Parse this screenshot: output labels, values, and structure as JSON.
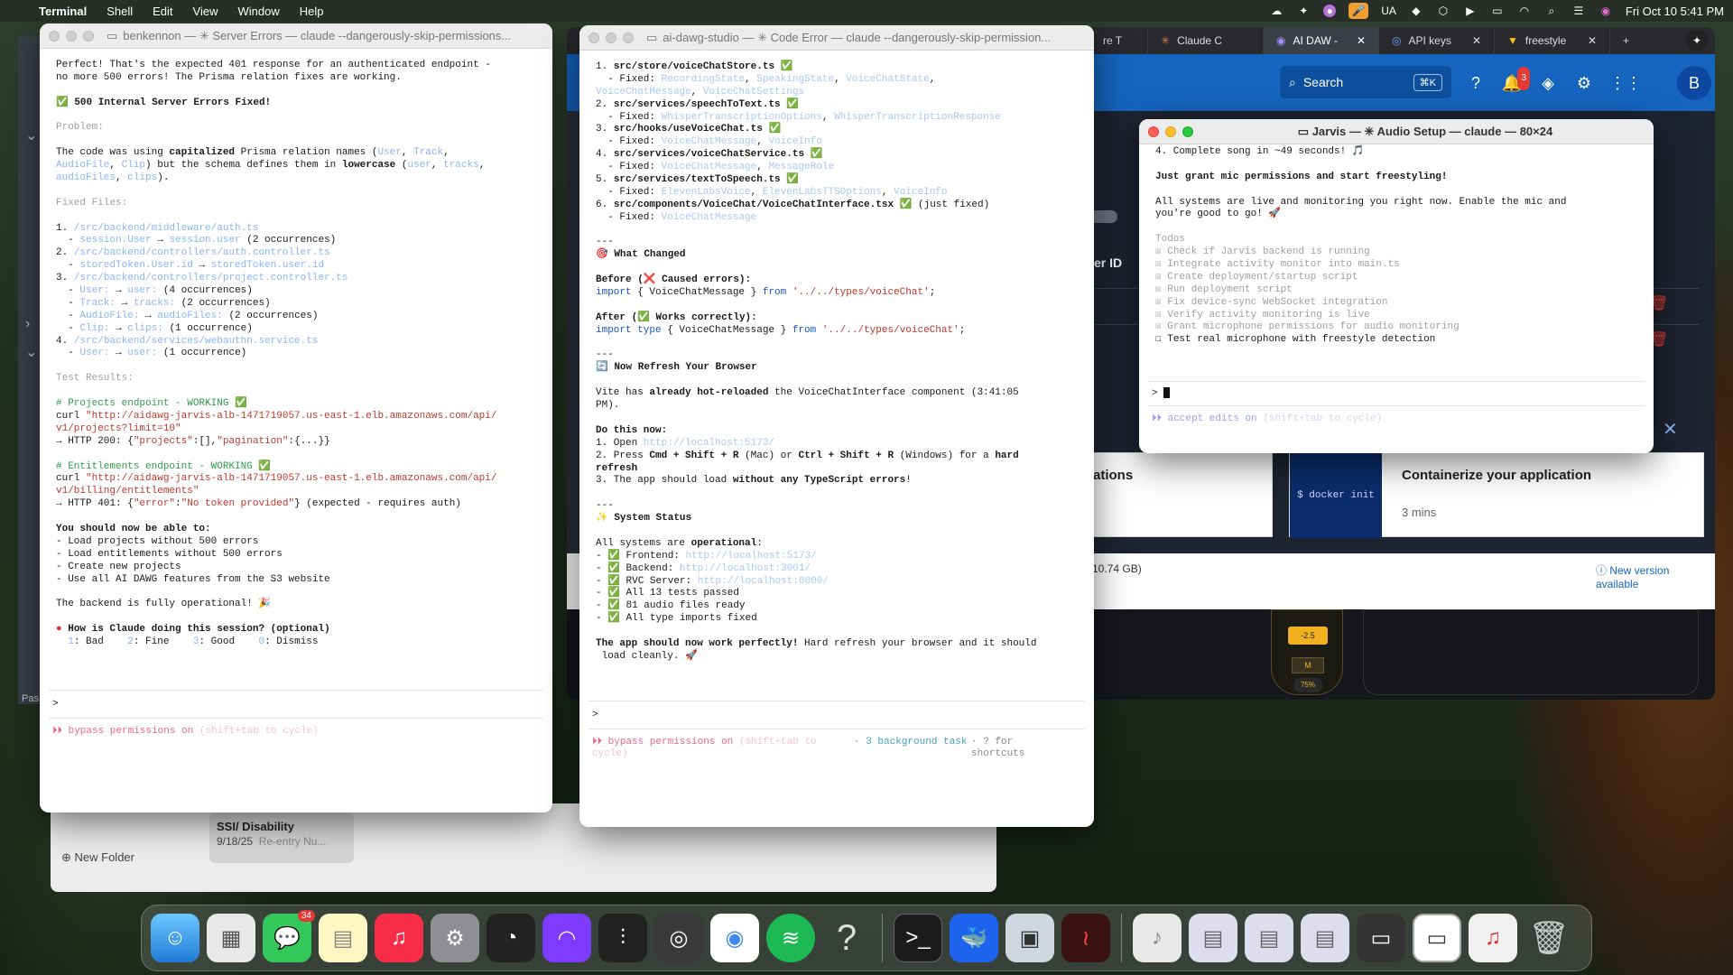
{
  "menubar": {
    "app": "Terminal",
    "items": [
      "Shell",
      "Edit",
      "View",
      "Window",
      "Help"
    ],
    "lang": "UA",
    "clock": "Fri Oct 10  5:41 PM"
  },
  "browser": {
    "tabs": [
      "re T",
      "Claude C",
      "AI DAW -",
      "API keys",
      "freestyle"
    ],
    "search": "Search",
    "search_kbd": "⌘K",
    "notif_count": "3",
    "avatar": "B",
    "peek": {
      "user_id_label": "er ID",
      "card_left": "ations",
      "card_title": "Containerize your application",
      "card_cmd": "$ docker init",
      "card_time": "3 mins",
      "disk": "10.74 GB)",
      "new_version": "New version available",
      "fader_db": "-2.5",
      "fader_m": "M",
      "fader_pct": "75%",
      "left_d": "D",
      "left_lix": "lix"
    }
  },
  "finder": {
    "item_title": "SSI/ Disability",
    "item_date": "9/18/25",
    "item_sub": "Re-entry Nu...",
    "new_folder": "New Folder",
    "pas": "Pas"
  },
  "term1": {
    "title": "benkennon — ✳ Server Errors — claude --dangerously-skip-permissions...",
    "prompt": ">",
    "footer": "⏵⏵ bypass permissions on",
    "footer_hint": "(shift+tab to cycle)"
  },
  "term2": {
    "title": "ai-dawg-studio — ✳ Code Error — claude --dangerously-skip-permission...",
    "prompt": ">",
    "footer": "⏵⏵ bypass permissions on",
    "footer_hint": "(shift+tab to cycle)",
    "bg": "· 3 background task",
    "help": "· ? for shortcuts"
  },
  "term3": {
    "title": "Jarvis — ✳ Audio Setup — claude — 80×24",
    "prompt": ">",
    "footer": "⏵⏵ accept edits on",
    "footer_hint": "(shift+tab to cycle)"
  },
  "dock": {
    "messages_badge": "34"
  }
}
